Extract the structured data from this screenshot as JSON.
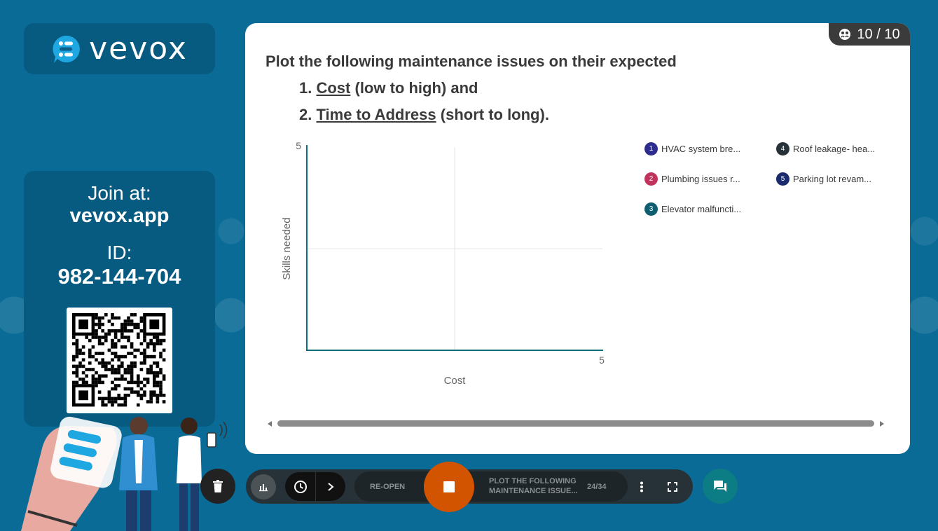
{
  "branding": {
    "logo_text": "vevox"
  },
  "join": {
    "join_label": "Join at:",
    "url": "vevox.app",
    "id_label": "ID:",
    "id_value": "982-144-704"
  },
  "question": {
    "participants": "10 / 10",
    "intro": "Plot the following maintenance issues on their expected",
    "item1_number": "1.",
    "item1_key": "Cost",
    "item1_rest": " (low to high) and",
    "item2_number": "2.",
    "item2_key": "Time to Address",
    "item2_rest": " (short to long)."
  },
  "legend": [
    {
      "number": "1",
      "label": "HVAC system bre...",
      "color": "#2e2d8f"
    },
    {
      "number": "2",
      "label": "Plumbing issues r...",
      "color": "#c0345c"
    },
    {
      "number": "3",
      "label": "Elevator malfuncti...",
      "color": "#0e5e6f"
    },
    {
      "number": "4",
      "label": "Roof leakage- hea...",
      "color": "#263238"
    },
    {
      "number": "5",
      "label": "Parking lot revam...",
      "color": "#1a2a6c"
    }
  ],
  "chart_data": {
    "type": "scatter",
    "xlabel": "Cost",
    "ylabel": "Skills needed",
    "xlim": [
      0,
      5
    ],
    "ylim": [
      0,
      5
    ],
    "x_tick_max": "5",
    "y_tick_max": "5",
    "series": []
  },
  "toolbar": {
    "reopen_label": "RE-OPEN",
    "question_title": "PLOT THE FOLLOWING MAINTENANCE ISSUE...",
    "position": "24/34"
  },
  "colors": {
    "background": "#0a6b96",
    "accent_stop": "#d35400",
    "chat": "#0d7d85",
    "axis": "#0e6e7a"
  }
}
